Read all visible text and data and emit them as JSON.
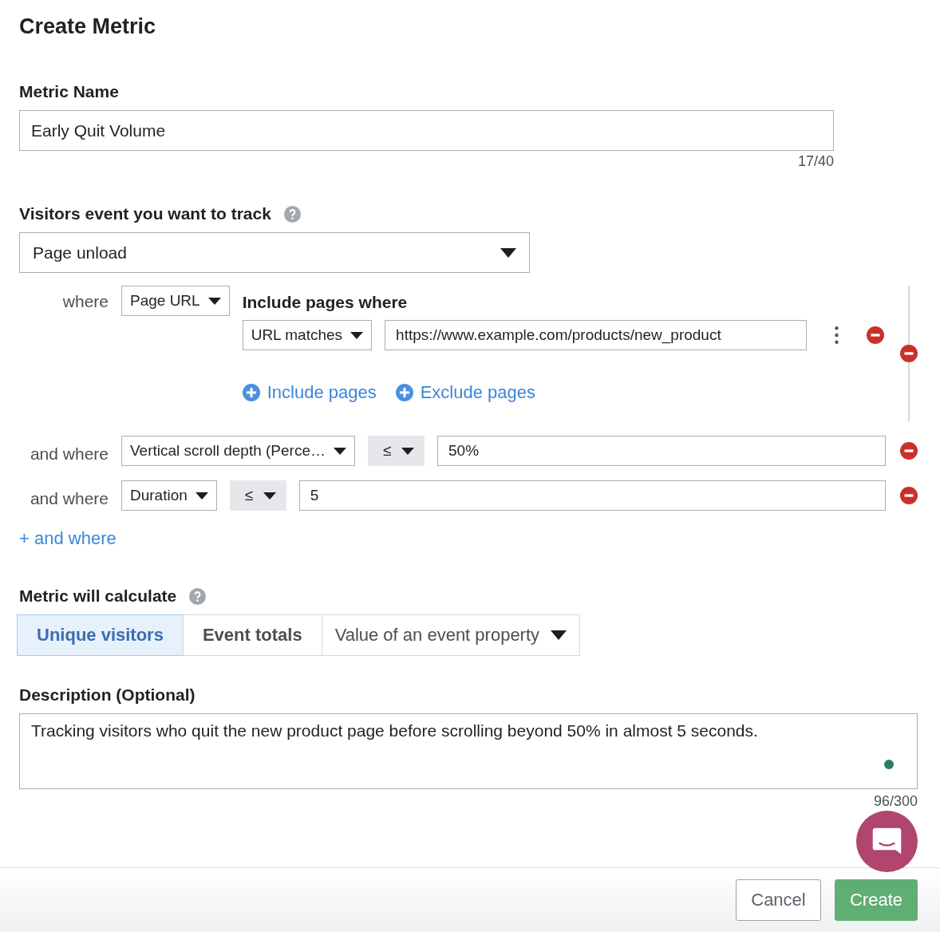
{
  "title": "Create Metric",
  "metric_name": {
    "label": "Metric Name",
    "value": "Early Quit Volume",
    "counter": "17/40"
  },
  "event": {
    "label": "Visitors event you want to track",
    "value": "Page unload"
  },
  "where": {
    "label": "where",
    "field": "Page URL",
    "heading": "Include pages where",
    "match": "URL matches",
    "url": "https://www.example.com/products/new_product",
    "links": [
      "Include pages",
      "Exclude pages"
    ]
  },
  "and_where": [
    {
      "label": "and where",
      "field": "Vertical scroll depth (Perce…",
      "operator": "≤",
      "value": "50%"
    },
    {
      "label": "and where",
      "field": "Duration",
      "operator": "≤",
      "value": "5"
    }
  ],
  "add_condition": "+ and where",
  "calculate": {
    "label": "Metric will calculate",
    "options": [
      {
        "label": "Unique visitors",
        "selected": true,
        "dropdown": false
      },
      {
        "label": "Event totals",
        "selected": false,
        "dropdown": false
      },
      {
        "label": "Value of an event property",
        "selected": false,
        "dropdown": true
      }
    ]
  },
  "description": {
    "label": "Description (Optional)",
    "value": "Tracking visitors who quit the new product page before scrolling beyond 50% in almost 5 seconds.",
    "counter": "96/300"
  },
  "buttons": {
    "cancel": "Cancel",
    "create": "Create"
  }
}
